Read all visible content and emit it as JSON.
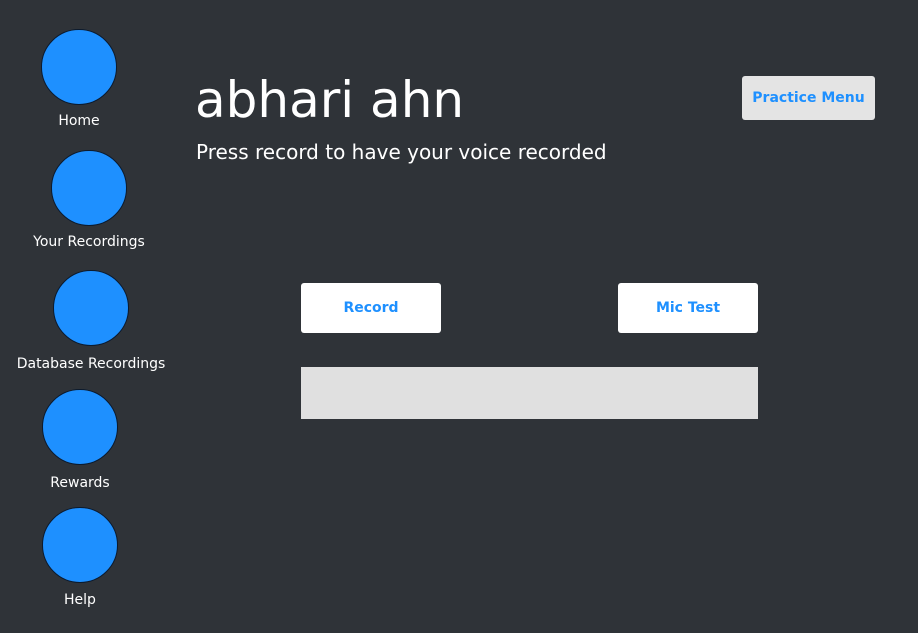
{
  "sidebar": {
    "items": [
      {
        "label": "Home",
        "icon": "home-icon"
      },
      {
        "label": "Your Recordings",
        "icon": "recordings-icon"
      },
      {
        "label": "Database Recordings",
        "icon": "database-icon"
      },
      {
        "label": "Rewards",
        "icon": "rewards-icon"
      },
      {
        "label": "Help",
        "icon": "help-icon"
      }
    ]
  },
  "header": {
    "title": "abhari ahn",
    "subtitle": "Press record to have your voice recorded",
    "practice_menu_label": "Practice Menu"
  },
  "main": {
    "record_label": "Record",
    "mic_test_label": "Mic Test",
    "output_text": ""
  },
  "colors": {
    "background": "#2f3338",
    "nav_circle": "#1e90ff",
    "button_text": "#1e90ff",
    "button_bg": "#ffffff",
    "output_bg": "#e0e0e0"
  }
}
